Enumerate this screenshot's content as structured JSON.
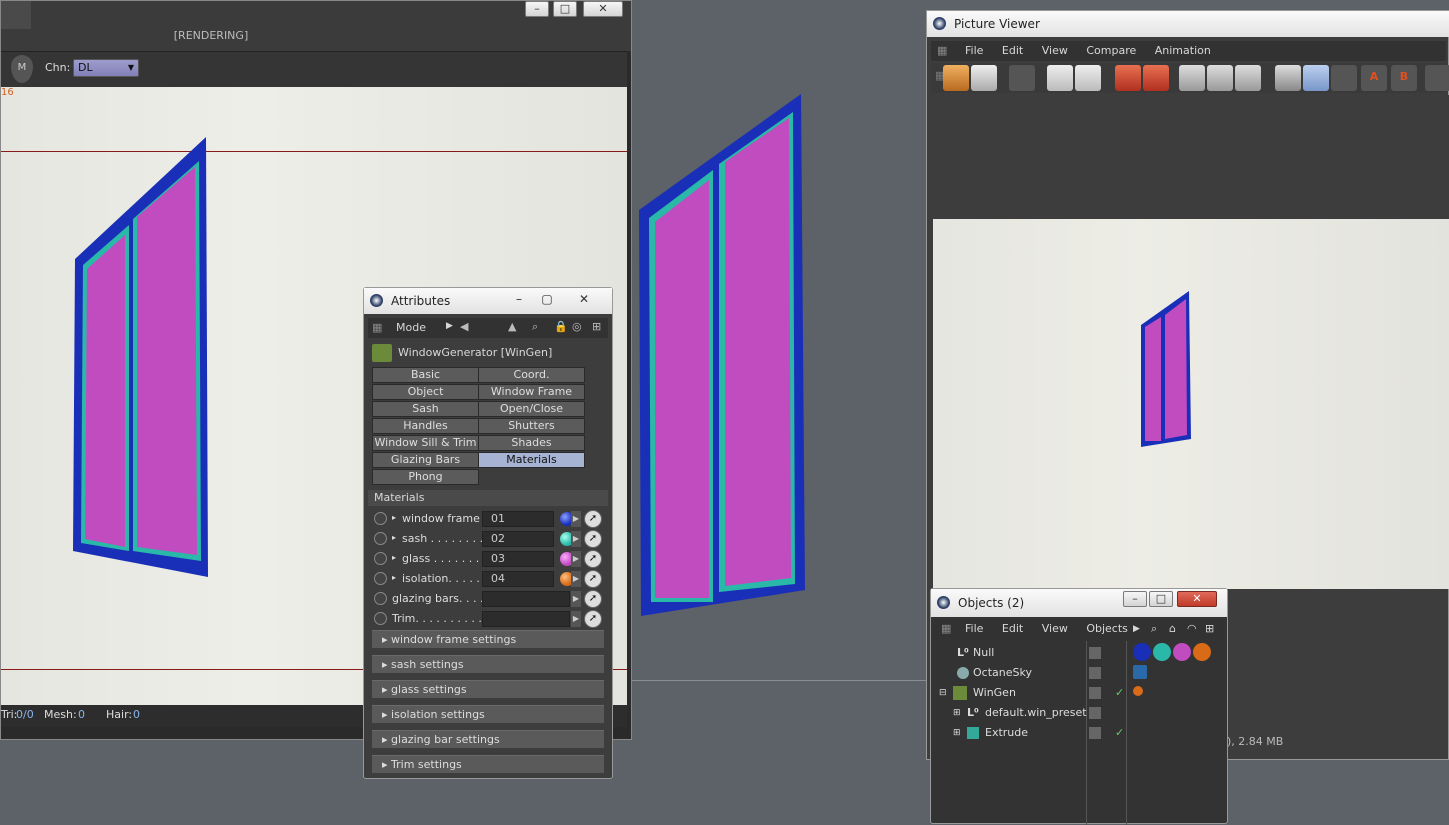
{
  "render_window": {
    "title": "[RENDERING]",
    "channel_label": "Chn:",
    "channel_value": "DL",
    "corner_number": "16",
    "status": {
      "tri_label": "Tri:",
      "tri_value": "0/0",
      "mesh_label": "Mesh:",
      "mesh_value": "0",
      "hair_label": "Hair:",
      "hair_value": "0"
    }
  },
  "attributes": {
    "title": "Attributes",
    "mode_label": "Mode",
    "object_name": "WindowGenerator [WinGen]",
    "tabs": [
      "Basic",
      "Coord.",
      "Object",
      "Window Frame",
      "Sash",
      "Open/Close",
      "Handles",
      "Shutters",
      "Window Sill & Trim",
      "Shades",
      "Glazing Bars",
      "Materials",
      "Phong"
    ],
    "active_tab": "Materials",
    "section_title": "Materials",
    "materials": [
      {
        "label": "window frame",
        "value": "01",
        "color": "#1a2fb8"
      },
      {
        "label": "sash . . . . . . . . .",
        "value": "02",
        "color": "#2ab8a8"
      },
      {
        "label": "glass . . . . . . . . .",
        "value": "03",
        "color": "#c04cc0"
      },
      {
        "label": "isolation. . . . .",
        "value": "04",
        "color": "#d86a18"
      },
      {
        "label": "glazing bars. . . .",
        "value": "",
        "color": ""
      },
      {
        "label": "Trim. . . . . . . . . .",
        "value": "",
        "color": ""
      }
    ],
    "sections": [
      "window frame settings",
      "sash settings",
      "glass settings",
      "isolation settings",
      "glazing bar settings",
      "Trim settings"
    ]
  },
  "picture_viewer": {
    "title": "Picture Viewer",
    "menu": [
      "File",
      "Edit",
      "View",
      "Compare",
      "Animation"
    ],
    "size_text": "), 2.84 MB"
  },
  "objects": {
    "title": "Objects (2)",
    "menu": [
      "File",
      "Edit",
      "View",
      "Objects"
    ],
    "rows": [
      "Null",
      "OctaneSky",
      "WinGen",
      "default.win_preset",
      "Extrude"
    ]
  },
  "colors": {
    "frame": "#1a2fb8",
    "sash": "#2ab8a8",
    "glass": "#c04cc0",
    "isolation": "#d86a18",
    "accent": "#a7b3d3"
  }
}
